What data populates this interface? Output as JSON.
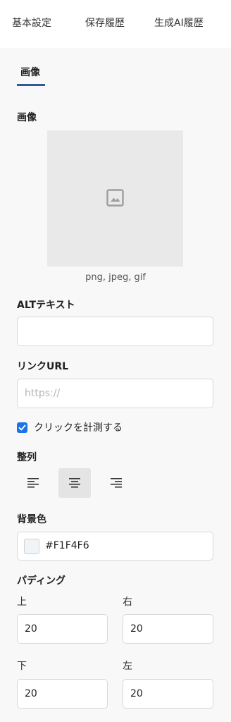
{
  "tabs": [
    "基本設定",
    "保存履歴",
    "生成AI履歴"
  ],
  "sub_tab": "画像",
  "image_section": {
    "label": "画像",
    "placeholder_icon": "image-placeholder-icon",
    "formats": "png, jpeg, gif"
  },
  "alt_text": {
    "label": "ALTテキスト",
    "value": ""
  },
  "link_url": {
    "label": "リンクURL",
    "placeholder": "https://",
    "value": ""
  },
  "track_click": {
    "label": "クリックを計測する",
    "checked": true
  },
  "alignment": {
    "label": "整列",
    "options": [
      "align-left-icon",
      "align-center-icon",
      "align-right-icon"
    ],
    "selected": "center"
  },
  "background_color": {
    "label": "背景色",
    "value": "#F1F4F6"
  },
  "padding": {
    "label": "パディング",
    "top_label": "上",
    "top_value": "20",
    "right_label": "右",
    "right_value": "20",
    "bottom_label": "下",
    "bottom_value": "20",
    "left_label": "左",
    "left_value": "20"
  },
  "colors": {
    "accent": "#2F5B9A",
    "checkbox": "#1A73E8",
    "image_bg": "#E9E9E9",
    "page_bg": "#F8F8F8"
  }
}
